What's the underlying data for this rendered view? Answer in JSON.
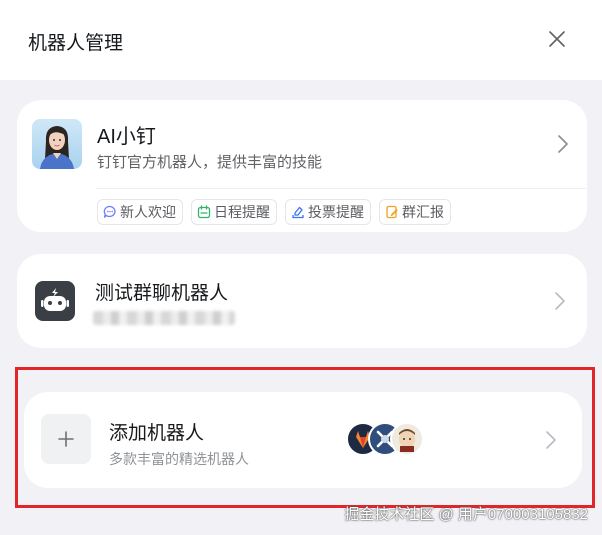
{
  "header": {
    "title": "机器人管理"
  },
  "ai_bot": {
    "name": "AI小钉",
    "description": "钉钉官方机器人，提供丰富的技能",
    "tags": [
      {
        "label": "新人欢迎",
        "icon": "chat-bubble-icon",
        "color": "#6b7cff"
      },
      {
        "label": "日程提醒",
        "icon": "calendar-icon",
        "color": "#2fb36b"
      },
      {
        "label": "投票提醒",
        "icon": "vote-icon",
        "color": "#3b73f5"
      },
      {
        "label": "群汇报",
        "icon": "report-icon",
        "color": "#f0a020"
      }
    ]
  },
  "test_bot": {
    "name": "测试群聊机器人"
  },
  "add_bot": {
    "name": "添加机器人",
    "description": "多款丰富的精选机器人"
  },
  "watermark": "掘金技术社区 @ 用户070003105832",
  "colors": {
    "highlight": "#e0262b",
    "background": "#f2f2f6"
  }
}
